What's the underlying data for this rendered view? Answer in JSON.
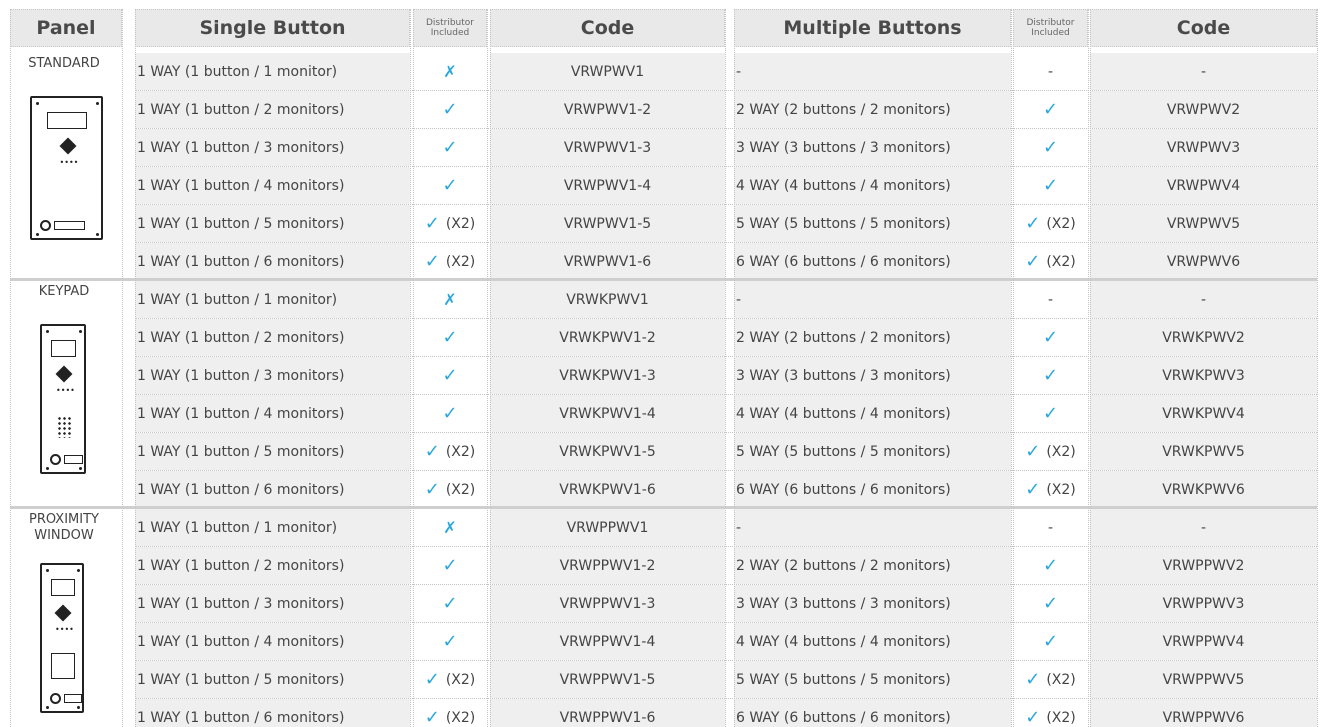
{
  "headers": {
    "panel": "Panel",
    "single": "Single Button",
    "dist1_line1": "Distributor",
    "dist1_line2": "Included",
    "code1": "Code",
    "multiple": "Multiple Buttons",
    "dist2_line1": "Distributor",
    "dist2_line2": "Included",
    "code2": "Code"
  },
  "colors": {
    "check": "#2aa7dd",
    "header_bg": "#e9e9e9",
    "row_bg": "#efefef"
  },
  "marks": {
    "check": "✓",
    "cross": "✗",
    "x2": "(X2)",
    "dash": "-"
  },
  "groups": [
    {
      "panel": "STANDARD",
      "rows": [
        {
          "single": "1 WAY (1 button / 1 monitor)",
          "dist1": "cross",
          "code1": "VRWPWV1",
          "multi": "-",
          "dist2": "dash",
          "code2": "-"
        },
        {
          "single": "1 WAY (1 button / 2 monitors)",
          "dist1": "check",
          "code1": "VRWPWV1-2",
          "multi": "2 WAY (2 buttons / 2 monitors)",
          "dist2": "check",
          "code2": "VRWPWV2"
        },
        {
          "single": "1 WAY (1 button / 3 monitors)",
          "dist1": "check",
          "code1": "VRWPWV1-3",
          "multi": "3 WAY (3 buttons / 3 monitors)",
          "dist2": "check",
          "code2": "VRWPWV3"
        },
        {
          "single": "1 WAY (1 button / 4 monitors)",
          "dist1": "check",
          "code1": "VRWPWV1-4",
          "multi": "4 WAY (4 buttons / 4 monitors)",
          "dist2": "check",
          "code2": "VRWPWV4"
        },
        {
          "single": "1 WAY (1 button / 5 monitors)",
          "dist1": "check2",
          "code1": "VRWPWV1-5",
          "multi": "5 WAY (5 buttons / 5 monitors)",
          "dist2": "check2",
          "code2": "VRWPWV5"
        },
        {
          "single": "1 WAY (1 button / 6 monitors)",
          "dist1": "check2",
          "code1": "VRWPWV1-6",
          "multi": "6 WAY (6 buttons / 6 monitors)",
          "dist2": "check2",
          "code2": "VRWPWV6"
        }
      ]
    },
    {
      "panel": "KEYPAD",
      "rows": [
        {
          "single": "1 WAY (1 button / 1 monitor)",
          "dist1": "cross",
          "code1": "VRWKPWV1",
          "multi": "-",
          "dist2": "dash",
          "code2": "-"
        },
        {
          "single": "1 WAY (1 button / 2 monitors)",
          "dist1": "check",
          "code1": "VRWKPWV1-2",
          "multi": "2 WAY (2 buttons / 2 monitors)",
          "dist2": "check",
          "code2": "VRWKPWV2"
        },
        {
          "single": "1 WAY (1 button / 3 monitors)",
          "dist1": "check",
          "code1": "VRWKPWV1-3",
          "multi": "3 WAY (3 buttons / 3 monitors)",
          "dist2": "check",
          "code2": "VRWKPWV3"
        },
        {
          "single": "1 WAY (1 button / 4 monitors)",
          "dist1": "check",
          "code1": "VRWKPWV1-4",
          "multi": "4 WAY (4 buttons / 4 monitors)",
          "dist2": "check",
          "code2": "VRWKPWV4"
        },
        {
          "single": "1 WAY (1 button / 5 monitors)",
          "dist1": "check2",
          "code1": "VRWKPWV1-5",
          "multi": "5 WAY (5 buttons / 5 monitors)",
          "dist2": "check2",
          "code2": "VRWKPWV5"
        },
        {
          "single": "1 WAY (1 button / 6 monitors)",
          "dist1": "check2",
          "code1": "VRWKPWV1-6",
          "multi": "6 WAY (6 buttons / 6 monitors)",
          "dist2": "check2",
          "code2": "VRWKPWV6"
        }
      ]
    },
    {
      "panel": "PROXIMITY WINDOW",
      "rows": [
        {
          "single": "1 WAY (1 button / 1 monitor)",
          "dist1": "cross",
          "code1": "VRWPPWV1",
          "multi": "-",
          "dist2": "dash",
          "code2": "-"
        },
        {
          "single": "1 WAY (1 button / 2 monitors)",
          "dist1": "check",
          "code1": "VRWPPWV1-2",
          "multi": "2 WAY (2 buttons / 2 monitors)",
          "dist2": "check",
          "code2": "VRWPPWV2"
        },
        {
          "single": "1 WAY (1 button / 3 monitors)",
          "dist1": "check",
          "code1": "VRWPPWV1-3",
          "multi": "3 WAY (3 buttons / 3 monitors)",
          "dist2": "check",
          "code2": "VRWPPWV3"
        },
        {
          "single": "1 WAY (1 button / 4 monitors)",
          "dist1": "check",
          "code1": "VRWPPWV1-4",
          "multi": "4 WAY (4 buttons / 4 monitors)",
          "dist2": "check",
          "code2": "VRWPPWV4"
        },
        {
          "single": "1 WAY (1 button / 5 monitors)",
          "dist1": "check2",
          "code1": "VRWPPWV1-5",
          "multi": "5 WAY (5 buttons / 5 monitors)",
          "dist2": "check2",
          "code2": "VRWPPWV5"
        },
        {
          "single": "1 WAY (1 button / 6 monitors)",
          "dist1": "check2",
          "code1": "VRWPPWV1-6",
          "multi": "6 WAY (6 buttons / 6 monitors)",
          "dist2": "check2",
          "code2": "VRWPPWV6"
        }
      ]
    }
  ]
}
